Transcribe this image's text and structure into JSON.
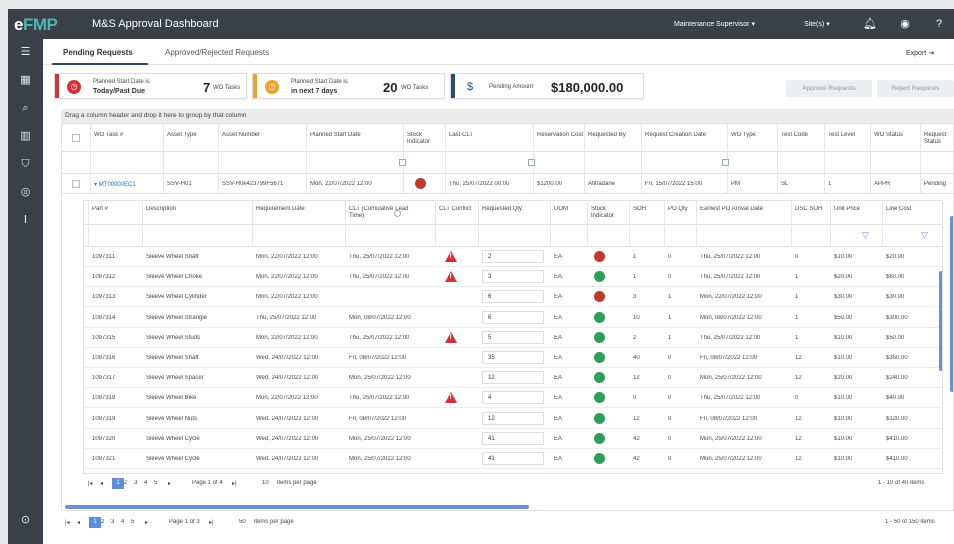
{
  "app": {
    "logo_mark": "e",
    "logo_text": "FMP",
    "title": "M&S Approval Dashboard",
    "role": "Maintenance Supervisor",
    "sites": "Site(s)"
  },
  "tabs": [
    {
      "label": "Pending Requests"
    },
    {
      "label": "Approved/Rejected Requests"
    }
  ],
  "export_label": "Export",
  "cards": [
    {
      "line1": "Planned Start Date is",
      "line2": "Today/Past Due",
      "value": "7",
      "unit": "WO Tasks",
      "color": "#d13438"
    },
    {
      "line1": "Planned Start Date is",
      "line2": "in next 7 days",
      "value": "20",
      "unit": "WO Tasks",
      "color": "#f0a32a"
    },
    {
      "line1": "Pending Amount",
      "value": "$180,000.00",
      "color": "#2c4a6e"
    }
  ],
  "buttons": {
    "approve": "Approve Requests",
    "reject": "Reject Requests"
  },
  "group_hint": "Drag a column header and drop it here to group by that column",
  "columns": [
    "WO Task #",
    "Asset Type",
    "Asset Number",
    "Planned Start Date",
    "Stock Indicator",
    "Last CLT",
    "Reservation Cost",
    "Requested By",
    "Request Creation Date",
    "WO Type",
    "Test Code",
    "Test Level",
    "WO Status",
    "Request Status"
  ],
  "wo_row": {
    "task": "MT00000EC1",
    "asset_type": "SSV-H01",
    "asset_number": "SSV-H0k423799F5671",
    "planned_start": "Mon, 22/07/2022 12:00",
    "last_clt": "Thu, 25/07/2022 00:00",
    "reservation_cost": "$1200.00",
    "requested_by": "Afihadane",
    "creation_date": "Fri, 15/07/2022 15:00",
    "wo_type": "PM",
    "test_code": "SL",
    "test_level": "1",
    "wo_status": "APPR",
    "request_status": "Pending"
  },
  "sub_columns": [
    "Part #",
    "Description",
    "Requirement Date",
    "CLT (Cumulative Lead Time)",
    "CLT Conflict",
    "Requested Qty",
    "UOM",
    "Stock Indicator",
    "SOH",
    "PO Qty",
    "Earliest PO Arrival Date",
    "DSC SOH",
    "Unit Price",
    "Line Cost"
  ],
  "parts": [
    {
      "part": "1097311",
      "desc": "Sleeve Wheel Shaft",
      "req": "Mon, 22/07/2022 12:00",
      "clt": "Thu, 25/07/2022 12:00",
      "conflict": true,
      "qty": "2",
      "uom": "EA",
      "stock": "red",
      "soh": "1",
      "po": "0",
      "arrival": "Thu, 25/07/2022 12:00",
      "dsc": "0",
      "price": "$10.00",
      "cost": "$20.00"
    },
    {
      "part": "1097312",
      "desc": "Sleeve Wheel Choke",
      "req": "Mon, 22/07/2022 12:00",
      "clt": "Thu, 25/07/2022 12:00",
      "conflict": true,
      "qty": "3",
      "uom": "EA",
      "stock": "green",
      "soh": "1",
      "po": "0",
      "arrival": "Thu, 25/07/2022 12:00",
      "dsc": "1",
      "price": "$20.00",
      "cost": "$60.00"
    },
    {
      "part": "1097313",
      "desc": "Sleeve Wheel Cylinder",
      "req": "Mon, 22/07/2022 12:00",
      "clt": "",
      "conflict": false,
      "qty": "6",
      "uom": "EA",
      "stock": "red",
      "soh": "3",
      "po": "1",
      "arrival": "Mon, 22/07/2022 12:00",
      "dsc": "1",
      "price": "$30.00",
      "cost": "$30.00"
    },
    {
      "part": "1097314",
      "desc": "Sleeve Wheel Strangle",
      "req": "Thu, 25/07/2022 12:00",
      "clt": "Mon, 08/07/2022 12:00",
      "conflict": false,
      "qty": "6",
      "uom": "EA",
      "stock": "green",
      "soh": "10",
      "po": "1",
      "arrival": "Mon, 08/07/2022 12:00",
      "dsc": "1",
      "price": "$50.00",
      "cost": "$300.00"
    },
    {
      "part": "1097315",
      "desc": "Sleeve Wheel Studs",
      "req": "Mon, 22/07/2022 12:00",
      "clt": "Thu, 25/07/2022 12:00",
      "conflict": true,
      "qty": "5",
      "uom": "EA",
      "stock": "green",
      "soh": "2",
      "po": "1",
      "arrival": "Thu, 25/07/2022 12:00",
      "dsc": "1",
      "price": "$10.00",
      "cost": "$50.00"
    },
    {
      "part": "1097316",
      "desc": "Sleeve Wheel Shaft",
      "req": "Wed, 24/07/2022 12:00",
      "clt": "Fri, 08/07/2022 12:00",
      "conflict": false,
      "qty": "35",
      "uom": "EA",
      "stock": "green",
      "soh": "40",
      "po": "0",
      "arrival": "Fri, 08/07/2022 12:00",
      "dsc": "12",
      "price": "$10.00",
      "cost": "$350.00"
    },
    {
      "part": "1097317",
      "desc": "Sleeve Wheel Spacer",
      "req": "Wed, 24/07/2022 12:00",
      "clt": "Mon, 25/07/2022 12:00",
      "conflict": false,
      "qty": "12",
      "uom": "EA",
      "stock": "green",
      "soh": "12",
      "po": "0",
      "arrival": "Mon, 25/07/2022 12:00",
      "dsc": "12",
      "price": "$20.00",
      "cost": "$240.00"
    },
    {
      "part": "1097318",
      "desc": "Sleeve Wheel Bike",
      "req": "Mon, 22/07/2022 12:00",
      "clt": "Thu, 25/07/2022 12:00",
      "conflict": true,
      "qty": "4",
      "uom": "EA",
      "stock": "green",
      "soh": "0",
      "po": "0",
      "arrival": "Thu, 25/07/2022 12:00",
      "dsc": "0",
      "price": "$10.00",
      "cost": "$40.00"
    },
    {
      "part": "1097319",
      "desc": "Sleeve Wheel Nuts",
      "req": "Wed, 24/07/2022 12:00",
      "clt": "Fri, 08/07/2022 12:00",
      "conflict": false,
      "qty": "12",
      "uom": "EA",
      "stock": "green",
      "soh": "12",
      "po": "0",
      "arrival": "Fri, 08/07/2022 12:00",
      "dsc": "12",
      "price": "$10.00",
      "cost": "$120.00"
    },
    {
      "part": "1097320",
      "desc": "Sleeve Wheel Cycle",
      "req": "Wed, 24/07/2022 12:00",
      "clt": "Mon, 25/07/2022 12:00",
      "conflict": false,
      "qty": "41",
      "uom": "EA",
      "stock": "green",
      "soh": "42",
      "po": "0",
      "arrival": "Mon, 25/07/2022 12:00",
      "dsc": "12",
      "price": "$10.00",
      "cost": "$410.00"
    },
    {
      "part": "1097321",
      "desc": "Sleeve Wheel Cycle",
      "req": "Wed, 24/07/2022 12:00",
      "clt": "Mon, 25/07/2022 12:00",
      "conflict": false,
      "qty": "41",
      "uom": "EA",
      "stock": "green",
      "soh": "42",
      "po": "0",
      "arrival": "Mon, 25/07/2022 12:00",
      "dsc": "12",
      "price": "$10.00",
      "cost": "$410.00"
    }
  ],
  "inner_pager": {
    "pages": [
      "1",
      "2",
      "3",
      "4",
      "5"
    ],
    "label": "Page 1 of 4",
    "per_page": "10",
    "per_page_label": "items per page",
    "range": "1 - 10 of 40 items"
  },
  "outer_pager": {
    "pages": [
      "1",
      "2",
      "3",
      "4",
      "5"
    ],
    "label": "Page 1 of 3",
    "per_page": "50",
    "per_page_label": "items per page",
    "range": "1 - 50 of 150 items"
  },
  "icons": {
    "stock_red": "#c0392b",
    "stock_green": "#2e9e5b"
  }
}
